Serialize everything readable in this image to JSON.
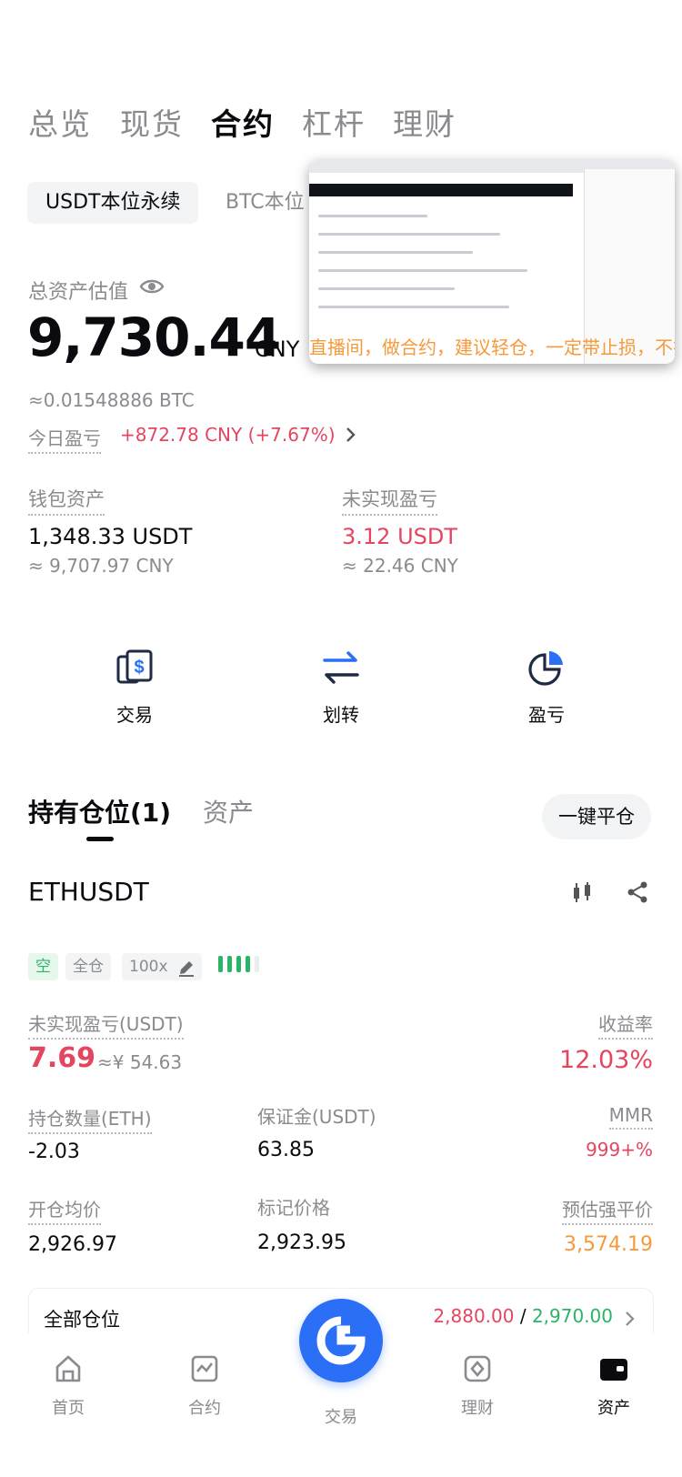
{
  "top_tabs": [
    "总览",
    "现货",
    "合约",
    "杠杆",
    "理财"
  ],
  "active_top_tab": "合约",
  "sub_tabs": {
    "usdt": "USDT本位永续",
    "btc": "BTC本位"
  },
  "overlay": {
    "caption": "直播间，做合约，建议轻仓，一定带止损，不打单"
  },
  "assets": {
    "label": "总资产估值",
    "value": "9,730.44",
    "unit": "CNY",
    "btc_equiv": "≈0.01548886 BTC",
    "today_pnl_label": "今日盈亏",
    "today_pnl_value": "+872.78 CNY (+7.67%)"
  },
  "wallet": {
    "label": "钱包资产",
    "value": "1,348.33 USDT",
    "approx": "≈ 9,707.97 CNY"
  },
  "unrealized": {
    "label": "未实现盈亏",
    "value": "3.12 USDT",
    "approx": "≈ 22.46 CNY"
  },
  "actions": [
    {
      "label": "交易",
      "icon": "trade-card-icon"
    },
    {
      "label": "划转",
      "icon": "transfer-arrows-icon"
    },
    {
      "label": "盈亏",
      "icon": "pie-chart-icon"
    }
  ],
  "position_tabs": {
    "holdings": "持有仓位(1)",
    "assets": "资产"
  },
  "close_all_label": "一键平仓",
  "position": {
    "symbol": "ETHUSDT",
    "direction": "空",
    "margin_mode": "全仓",
    "leverage": "100x",
    "unrealized_label": "未实现盈亏(USDT)",
    "unrealized_value": "7.69",
    "unrealized_cny": "≈¥ 54.63",
    "roe_label": "收益率",
    "roe_value": "12.03%",
    "size_label": "持仓数量(ETH)",
    "size_value": "-2.03",
    "margin_label": "保证金(USDT)",
    "margin_value": "63.85",
    "mmr_label": "MMR",
    "mmr_value": "999+%",
    "entry_label": "开仓均价",
    "entry_value": "2,926.97",
    "mark_label": "标记价格",
    "mark_value": "2,923.95",
    "liq_label": "预估强平价",
    "liq_value": "3,574.19"
  },
  "all_positions": {
    "label": "全部仓位",
    "low": "2,880.00",
    "sep": "/",
    "high": "2,970.00"
  },
  "bottom_nav": [
    {
      "label": "首页",
      "icon": "home-icon"
    },
    {
      "label": "合约",
      "icon": "futures-chart-icon"
    },
    {
      "label": "交易",
      "icon": "trade-logo-icon"
    },
    {
      "label": "理财",
      "icon": "finance-icon"
    },
    {
      "label": "资产",
      "icon": "wallet-icon"
    }
  ],
  "colors": {
    "accent": "#2a6ff6",
    "loss": "#e4465f",
    "gain": "#2ab466",
    "warn": "#f59a3c"
  }
}
